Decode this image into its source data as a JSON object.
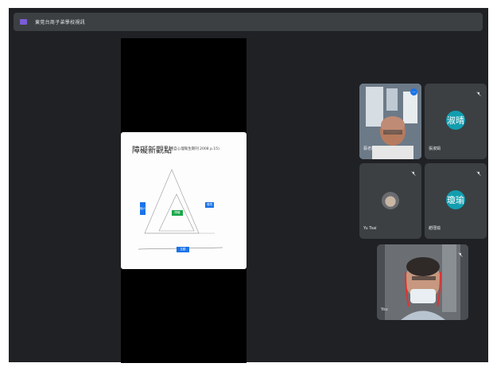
{
  "meeting": {
    "title": "東莞台商子弟學校視訊"
  },
  "slide": {
    "title": "障礙新觀點",
    "subtitle": "(選自心理衛生期刊 2008 p.15)",
    "left_label": "個人",
    "right_label": "環境",
    "center_label": "障礙",
    "bottom_label": "互動"
  },
  "participants": [
    {
      "name": "蔡老師",
      "type": "video",
      "active": true
    },
    {
      "name": "張淑娟",
      "type": "avatar",
      "initials": "淑晴",
      "color": "#129eaf",
      "muted": true
    },
    {
      "name": "Yu Tsai",
      "type": "photo",
      "muted": true
    },
    {
      "name": "趙瑾瑜",
      "type": "avatar",
      "initials": "瓊瑜",
      "color": "#129eaf",
      "muted": true
    },
    {
      "name": "You",
      "type": "self-video",
      "muted": true
    }
  ],
  "icons": {
    "app_logo": "meet-logo-icon",
    "mute": "mic-off-icon",
    "more": "more-options-icon"
  }
}
